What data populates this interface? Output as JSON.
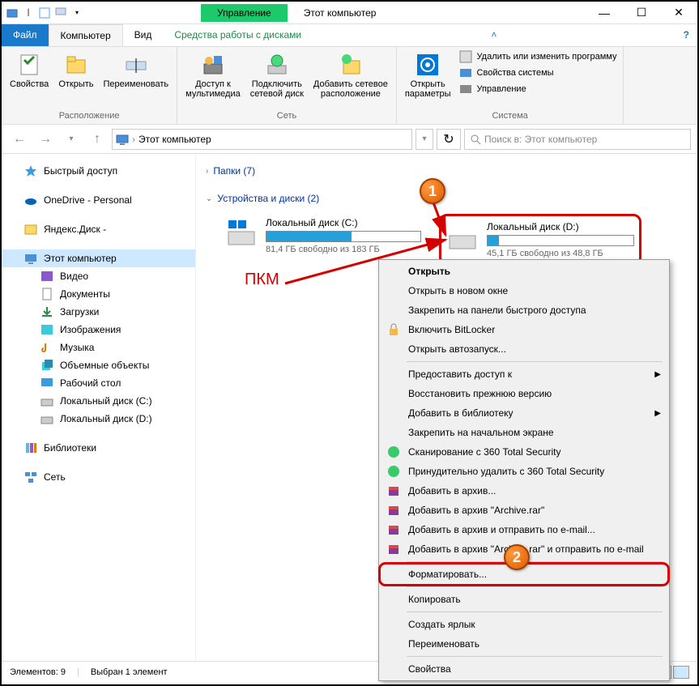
{
  "title": {
    "manage": "Управление",
    "window": "Этот компьютер"
  },
  "tabs": {
    "file": "Файл",
    "computer": "Компьютер",
    "view": "Вид",
    "drivetools": "Средства работы с дисками"
  },
  "ribbon": {
    "location": {
      "properties": "Свойства",
      "open": "Открыть",
      "rename": "Переименовать",
      "group": "Расположение"
    },
    "network": {
      "media": "Доступ к\nмультимедиа",
      "mapdrive": "Подключить\nсетевой диск",
      "addnet": "Добавить сетевое\nрасположение",
      "group": "Сеть"
    },
    "system": {
      "settings": "Открыть\nпараметры",
      "uninstall": "Удалить или изменить программу",
      "sysprops": "Свойства системы",
      "manage": "Управление",
      "group": "Система"
    }
  },
  "nav": {
    "address": "Этот компьютер",
    "search_placeholder": "Поиск в: Этот компьютер"
  },
  "sidebar": {
    "quick": "Быстрый доступ",
    "onedrive": "OneDrive - Personal",
    "yandex": "Яндекс.Диск -",
    "thispc": "Этот компьютер",
    "videos": "Видео",
    "documents": "Документы",
    "downloads": "Загрузки",
    "pictures": "Изображения",
    "music": "Музыка",
    "objects3d": "Объемные объекты",
    "desktop": "Рабочий стол",
    "diskc": "Локальный диск (C:)",
    "diskd": "Локальный диск (D:)",
    "libraries": "Библиотеки",
    "network": "Сеть"
  },
  "content": {
    "folders": "Папки (7)",
    "devices": "Устройства и диски (2)",
    "drive_c": {
      "name": "Локальный диск (C:)",
      "free": "81,4 ГБ свободно из 183 ГБ"
    },
    "drive_d": {
      "name": "Локальный диск (D:)",
      "free": "45,1 ГБ свободно из 48,8 ГБ"
    }
  },
  "ctx": {
    "open": "Открыть",
    "open_new": "Открыть в новом окне",
    "pin_quick": "Закрепить на панели быстрого доступа",
    "bitlocker": "Включить BitLocker",
    "autoplay": "Открыть автозапуск...",
    "share": "Предоставить доступ к",
    "restore": "Восстановить прежнюю версию",
    "library": "Добавить в библиотеку",
    "pin_start": "Закрепить на начальном экране",
    "scan360": "Сканирование с 360 Total Security",
    "del360": "Принудительно удалить с  360 Total Security",
    "archive": "Добавить в архив...",
    "archive_rar": "Добавить в архив \"Archive.rar\"",
    "archive_mail": "Добавить в архив и отправить по e-mail...",
    "archive_rar_mail": "Добавить в архив \"Archive.rar\" и отправить по e-mail",
    "format": "Форматировать...",
    "copy": "Копировать",
    "shortcut": "Создать ярлык",
    "rename": "Переименовать",
    "properties": "Свойства"
  },
  "status": {
    "count": "Элементов: 9",
    "selected": "Выбран 1 элемент"
  },
  "annot": {
    "rmb": "ПКМ"
  },
  "chart_data": {
    "type": "bar",
    "title": "Drive usage",
    "series": [
      {
        "name": "Локальный диск (C:)",
        "free_gb": 81.4,
        "total_gb": 183,
        "used_pct": 55
      },
      {
        "name": "Локальный диск (D:)",
        "free_gb": 45.1,
        "total_gb": 48.8,
        "used_pct": 8
      }
    ]
  }
}
